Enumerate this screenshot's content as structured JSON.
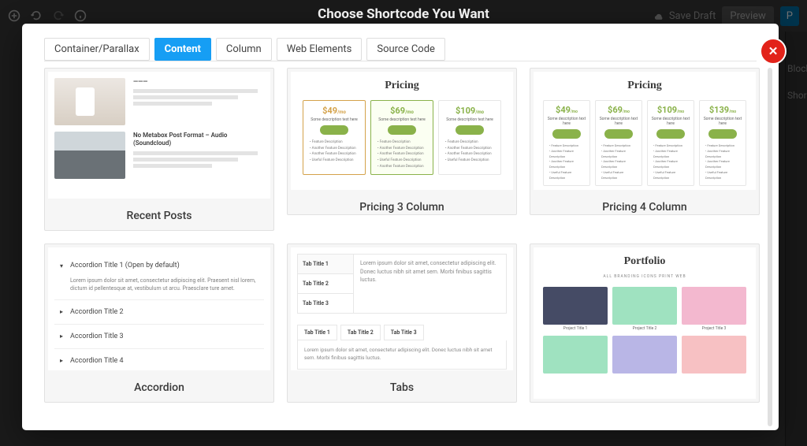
{
  "page": {
    "title": "Choose Shortcode You Want"
  },
  "header": {
    "save_draft": "Save Draft",
    "preview": "Preview",
    "publish": "P"
  },
  "sidebar": {
    "block": "Block",
    "short": "Short"
  },
  "modal": {
    "tabs": {
      "container": "Container/Parallax",
      "content": "Content",
      "column": "Column",
      "web_elements": "Web Elements",
      "source_code": "Source Code"
    }
  },
  "cards": {
    "recent_posts": {
      "label": "Recent Posts",
      "post1_title": "———",
      "post2_title": "No Metabox Post Format – Audio (Soundcloud)"
    },
    "pricing3": {
      "label": "Pricing 3 Column",
      "title": "Pricing",
      "cols": {
        "p1": {
          "price": "$49",
          "per": "/mo"
        },
        "p2": {
          "price": "$69",
          "per": "/mo"
        },
        "p3": {
          "price": "$109",
          "per": "/mo"
        }
      },
      "desc": "Some description text here",
      "features": [
        "Feature Description",
        "Another Feature Description",
        "Another Feature Description",
        "Useful Feature Description",
        "Another Feature Description"
      ]
    },
    "pricing4": {
      "label": "Pricing 4 Column",
      "title": "Pricing",
      "cols": {
        "p1": {
          "price": "$49",
          "per": "/mo"
        },
        "p2": {
          "price": "$69",
          "per": "/mo"
        },
        "p3": {
          "price": "$109",
          "per": "/mo"
        },
        "p4": {
          "price": "$139",
          "per": "/mo"
        }
      },
      "desc": "Some description text here",
      "features": [
        "Feature Description",
        "Another Feature Description",
        "Another Feature Description",
        "Useful Feature Description",
        "Another Feature Description"
      ]
    },
    "accordion": {
      "label": "Accordion",
      "items": {
        "i0": "Accordion Title 1 (Open by default)",
        "i1": "Accordion Title 2",
        "i2": "Accordion Title 3",
        "i3": "Accordion Title 4"
      },
      "body": "Lorem ipsum dolor sit amet, consectetur adipiscing elit. Praesent nisl lorem, dictum id pellentesque at, vestibulum ut arcu. Praesclare ture amet."
    },
    "tabs": {
      "label": "Tabs",
      "vertical": {
        "t1": "Tab Title 1",
        "t2": "Tab Title 2",
        "t3": "Tab Title 3"
      },
      "horizontal": {
        "t1": "Tab Title 1",
        "t2": "Tab Title 2",
        "t3": "Tab Title 3"
      },
      "lorem": "Lorem ipsum dolor sit amet, consectetur adipiscing elit. Donec luctus nibh sit amet sem. Morbi finibus sagittis luctus."
    },
    "portfolio": {
      "label": "Portfolio",
      "title": "Portfolio",
      "filter": "ALL   BRANDING   ICONS   PRINT   WEB",
      "caps": {
        "c1": "Project Title 1",
        "c2": "Project Title 2",
        "c3": "Project Title 3"
      }
    }
  }
}
